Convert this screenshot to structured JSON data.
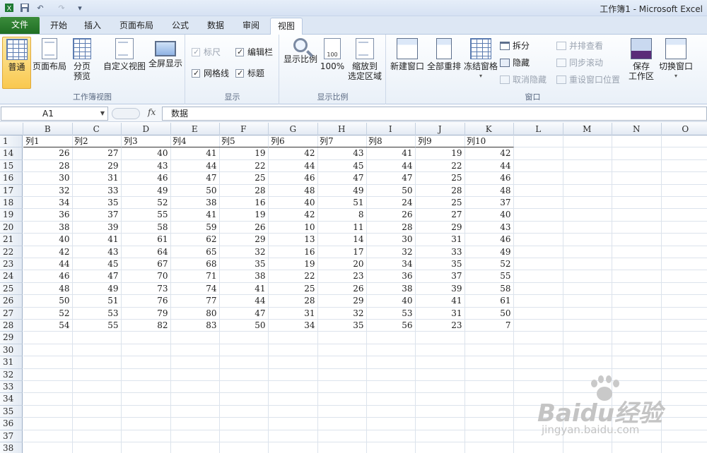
{
  "window": {
    "title": "工作簿1 - Microsoft Excel"
  },
  "quick_access": {
    "undo_label": "↶",
    "redo_label": "↷",
    "customize_label": "▾"
  },
  "tabs": [
    {
      "label": "文件"
    },
    {
      "label": "开始"
    },
    {
      "label": "插入"
    },
    {
      "label": "页面布局"
    },
    {
      "label": "公式"
    },
    {
      "label": "数据"
    },
    {
      "label": "审阅"
    },
    {
      "label": "视图"
    }
  ],
  "ribbon": {
    "workbook_views": {
      "label": "工作簿视图",
      "normal": "普通",
      "page_layout": "页面布局",
      "page_break_1": "分页",
      "page_break_2": "预览",
      "custom_views": "自定义视图",
      "full_screen": "全屏显示"
    },
    "show": {
      "label": "显示",
      "ruler": "标尺",
      "formula_bar": "编辑栏",
      "gridlines": "网格线",
      "headings": "标题"
    },
    "zoom": {
      "label": "显示比例",
      "zoom": "显示比例",
      "zoom100": "100%",
      "zoom_sel_1": "缩放到",
      "zoom_sel_2": "选定区域",
      "zoom100_icon_text": "100"
    },
    "window": {
      "label": "窗口",
      "new_window": "新建窗口",
      "arrange_all": "全部重排",
      "freeze_panes": "冻结窗格",
      "split": "拆分",
      "hide": "隐藏",
      "unhide": "取消隐藏",
      "side_by_side": "并排查看",
      "sync_scroll": "同步滚动",
      "reset_position": "重设窗口位置",
      "save_ws_1": "保存",
      "save_ws_2": "工作区",
      "switch_windows": "切换窗口"
    }
  },
  "formula_bar": {
    "name_box": "A1",
    "fx_label": "fx",
    "content": "数据"
  },
  "sheet": {
    "columns": [
      "B",
      "C",
      "D",
      "E",
      "F",
      "G",
      "H",
      "I",
      "J",
      "K",
      "L",
      "M",
      "N",
      "O"
    ],
    "header_row_number": "1",
    "header_labels": [
      "列1",
      "列2",
      "列3",
      "列4",
      "列5",
      "列6",
      "列7",
      "列8",
      "列9",
      "列10"
    ],
    "rows": [
      {
        "n": "14",
        "v": [
          "26",
          "27",
          "40",
          "41",
          "19",
          "42",
          "43",
          "41",
          "19",
          "42"
        ]
      },
      {
        "n": "15",
        "v": [
          "28",
          "29",
          "43",
          "44",
          "22",
          "44",
          "45",
          "44",
          "22",
          "44"
        ]
      },
      {
        "n": "16",
        "v": [
          "30",
          "31",
          "46",
          "47",
          "25",
          "46",
          "47",
          "47",
          "25",
          "46"
        ]
      },
      {
        "n": "17",
        "v": [
          "32",
          "33",
          "49",
          "50",
          "28",
          "48",
          "49",
          "50",
          "28",
          "48"
        ]
      },
      {
        "n": "18",
        "v": [
          "34",
          "35",
          "52",
          "38",
          "16",
          "40",
          "51",
          "24",
          "25",
          "37"
        ]
      },
      {
        "n": "19",
        "v": [
          "36",
          "37",
          "55",
          "41",
          "19",
          "42",
          "8",
          "26",
          "27",
          "40"
        ]
      },
      {
        "n": "20",
        "v": [
          "38",
          "39",
          "58",
          "59",
          "26",
          "10",
          "11",
          "28",
          "29",
          "43"
        ]
      },
      {
        "n": "21",
        "v": [
          "40",
          "41",
          "61",
          "62",
          "29",
          "13",
          "14",
          "30",
          "31",
          "46"
        ]
      },
      {
        "n": "22",
        "v": [
          "42",
          "43",
          "64",
          "65",
          "32",
          "16",
          "17",
          "32",
          "33",
          "49"
        ]
      },
      {
        "n": "23",
        "v": [
          "44",
          "45",
          "67",
          "68",
          "35",
          "19",
          "20",
          "34",
          "35",
          "52"
        ]
      },
      {
        "n": "24",
        "v": [
          "46",
          "47",
          "70",
          "71",
          "38",
          "22",
          "23",
          "36",
          "37",
          "55"
        ]
      },
      {
        "n": "25",
        "v": [
          "48",
          "49",
          "73",
          "74",
          "41",
          "25",
          "26",
          "38",
          "39",
          "58"
        ]
      },
      {
        "n": "26",
        "v": [
          "50",
          "51",
          "76",
          "77",
          "44",
          "28",
          "29",
          "40",
          "41",
          "61"
        ]
      },
      {
        "n": "27",
        "v": [
          "52",
          "53",
          "79",
          "80",
          "47",
          "31",
          "32",
          "53",
          "31",
          "50"
        ]
      },
      {
        "n": "28",
        "v": [
          "54",
          "55",
          "82",
          "83",
          "50",
          "34",
          "35",
          "56",
          "23",
          "7"
        ]
      }
    ],
    "empty_rows": [
      "29",
      "30",
      "31",
      "32",
      "33",
      "34",
      "35",
      "36",
      "37",
      "38"
    ]
  },
  "watermark": {
    "brand": "Baidu经验",
    "url": "jingyan.baidu.com"
  }
}
